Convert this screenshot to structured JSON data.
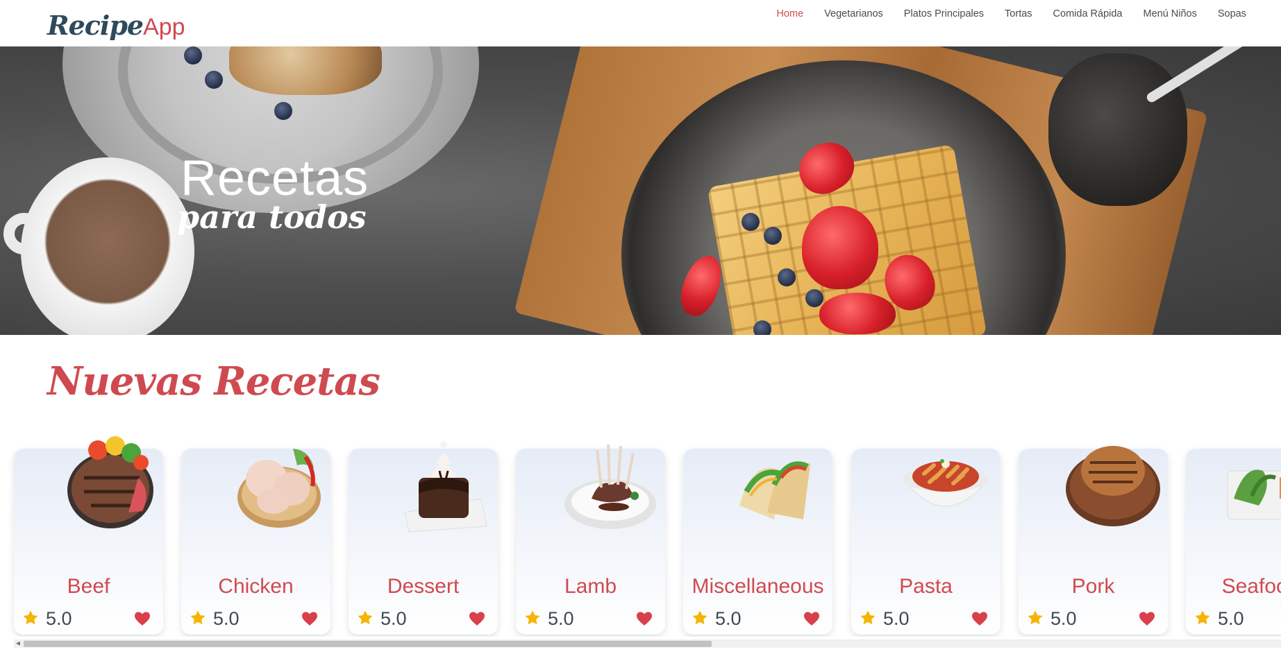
{
  "header": {
    "logo_part1": "Recipe",
    "logo_part2": "App",
    "nav": [
      {
        "label": "Home",
        "active": true
      },
      {
        "label": "Vegetarianos"
      },
      {
        "label": "Platos Principales"
      },
      {
        "label": "Tortas"
      },
      {
        "label": "Comida Rápida"
      },
      {
        "label": "Menú Niños"
      },
      {
        "label": "Sopas"
      }
    ]
  },
  "hero": {
    "title": "Recetas",
    "subtitle": "para todos"
  },
  "section": {
    "title": "Nuevas Recetas"
  },
  "cards": [
    {
      "name": "Beef",
      "rating": "5.0",
      "image": "beef-steak-image"
    },
    {
      "name": "Chicken",
      "rating": "5.0",
      "image": "chicken-image"
    },
    {
      "name": "Dessert",
      "rating": "5.0",
      "image": "dessert-image"
    },
    {
      "name": "Lamb",
      "rating": "5.0",
      "image": "lamb-image"
    },
    {
      "name": "Miscellaneous",
      "rating": "5.0",
      "image": "tacos-image"
    },
    {
      "name": "Pasta",
      "rating": "5.0",
      "image": "pasta-image"
    },
    {
      "name": "Pork",
      "rating": "5.0",
      "image": "pork-image"
    },
    {
      "name": "Seafood",
      "rating": "5.0",
      "image": "seafood-image"
    }
  ],
  "colors": {
    "accent": "#cf4a50",
    "star": "#f5b400",
    "heart": "#d8404a",
    "logo_dark": "#2e4a5c"
  }
}
